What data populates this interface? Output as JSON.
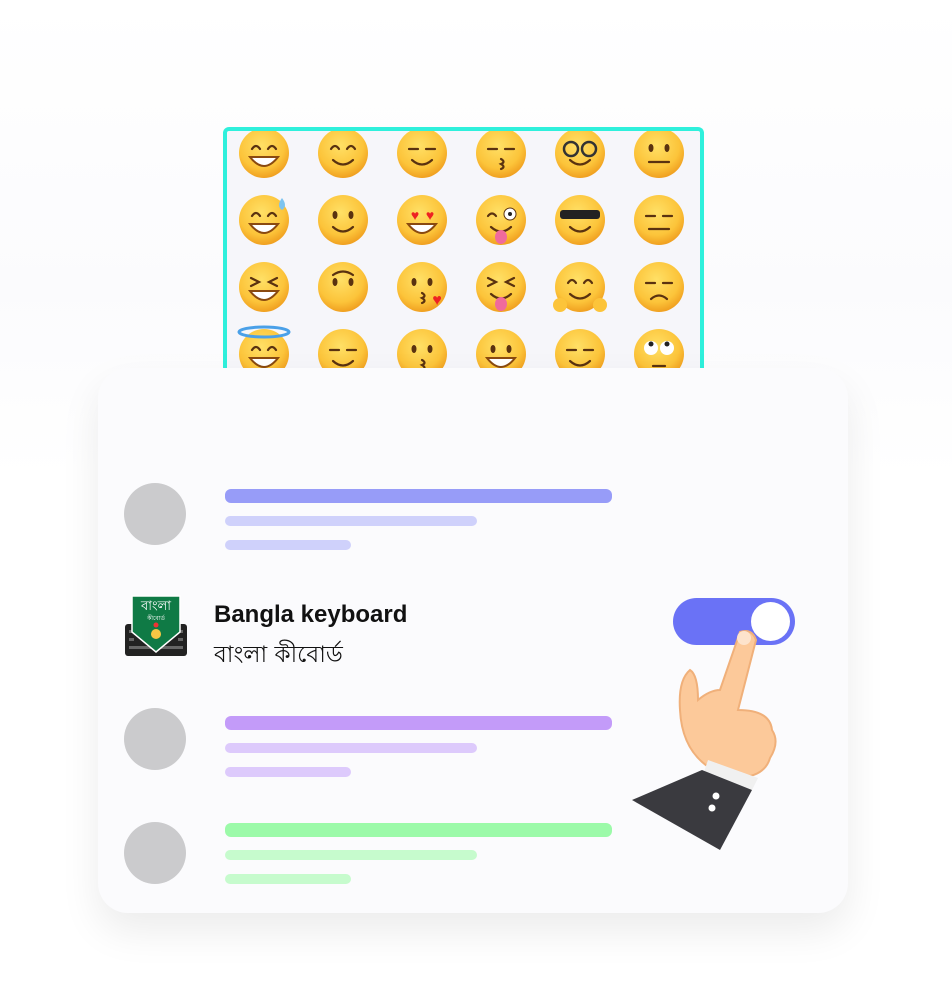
{
  "emoji_grid": {
    "border_color": "#2ff0dc",
    "rows": [
      [
        "grinning-smiling-eyes",
        "smiling-eyes",
        "relieved",
        "kissing-smiling-eyes",
        "nerd",
        "neutral"
      ],
      [
        "sweat-smile",
        "slight-smile",
        "heart-eyes",
        "wink-tongue",
        "sunglasses",
        "expressionless"
      ],
      [
        "laughing",
        "upside-down",
        "kiss-heart",
        "squint-tongue",
        "hugging",
        "unamused"
      ],
      [
        "halo",
        "blush",
        "kissing",
        "grinning",
        "smirk",
        "eye-roll"
      ]
    ]
  },
  "list": {
    "placeholder_rows": [
      {
        "colors": [
          "#979cf8",
          "#cfd1fb",
          "#cfd1fb"
        ]
      },
      {
        "colors": [
          "#c39bf9",
          "#ddcafc",
          "#ddcafc"
        ]
      },
      {
        "colors": [
          "#9cfaa9",
          "#c6fbcd",
          "#c6fbcd"
        ]
      }
    ],
    "keyboard_item": {
      "title": "Bangla keyboard",
      "subtitle": "বাংলা কীবোর্ড",
      "icon_logo_text": "বাংলা কীবোর্ড",
      "toggle_on": true,
      "toggle_color": "#6a72f6"
    }
  }
}
